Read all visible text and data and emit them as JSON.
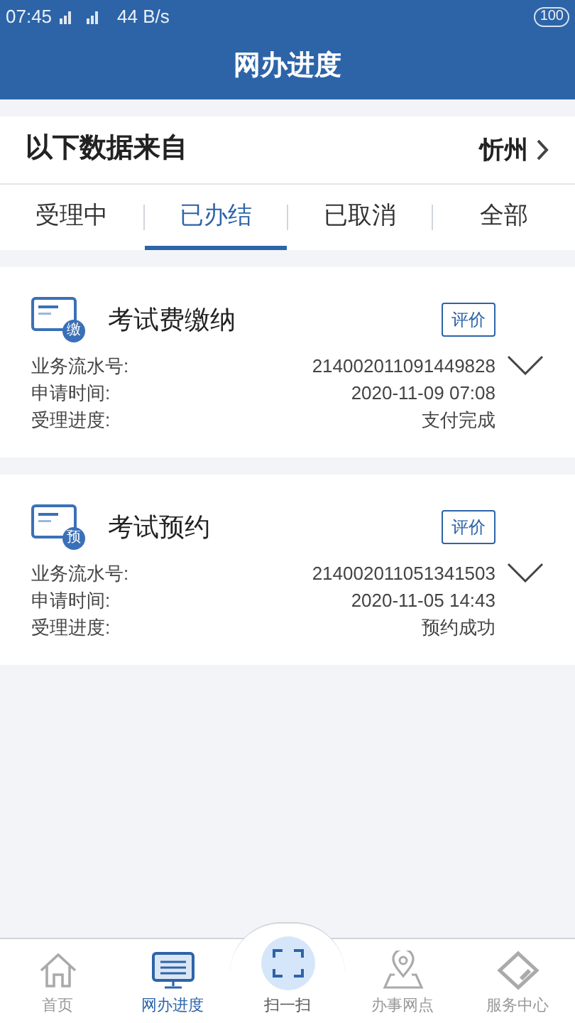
{
  "status_bar": {
    "time": "07:45",
    "speed": "44 B/s",
    "battery": "100"
  },
  "header": {
    "title": "网办进度"
  },
  "source": {
    "label": "以下数据来自",
    "city": "忻州"
  },
  "tabs": [
    {
      "label": "受理中",
      "selected": false
    },
    {
      "label": "已办结",
      "selected": true
    },
    {
      "label": "已取消",
      "selected": false
    },
    {
      "label": "全部",
      "selected": false
    }
  ],
  "records": [
    {
      "title": "考试费缴纳",
      "badge": "缴",
      "action": "评价",
      "fields": [
        {
          "label": "业务流水号:",
          "value": "214002011091449828"
        },
        {
          "label": "申请时间:",
          "value": "2020-11-09 07:08"
        },
        {
          "label": "受理进度:",
          "value": "支付完成"
        }
      ]
    },
    {
      "title": "考试预约",
      "badge": "预",
      "action": "评价",
      "fields": [
        {
          "label": "业务流水号:",
          "value": "214002011051341503"
        },
        {
          "label": "申请时间:",
          "value": "2020-11-05 14:43"
        },
        {
          "label": "受理进度:",
          "value": "预约成功"
        }
      ]
    }
  ],
  "nav": [
    {
      "kind": "home",
      "label": "首页",
      "selected": false
    },
    {
      "kind": "monitor",
      "label": "网办进度",
      "selected": true
    },
    {
      "kind": "scan",
      "label": "扫一扫",
      "selected": false
    },
    {
      "kind": "pin",
      "label": "办事网点",
      "selected": false
    },
    {
      "kind": "diamond",
      "label": "服务中心",
      "selected": false
    }
  ]
}
